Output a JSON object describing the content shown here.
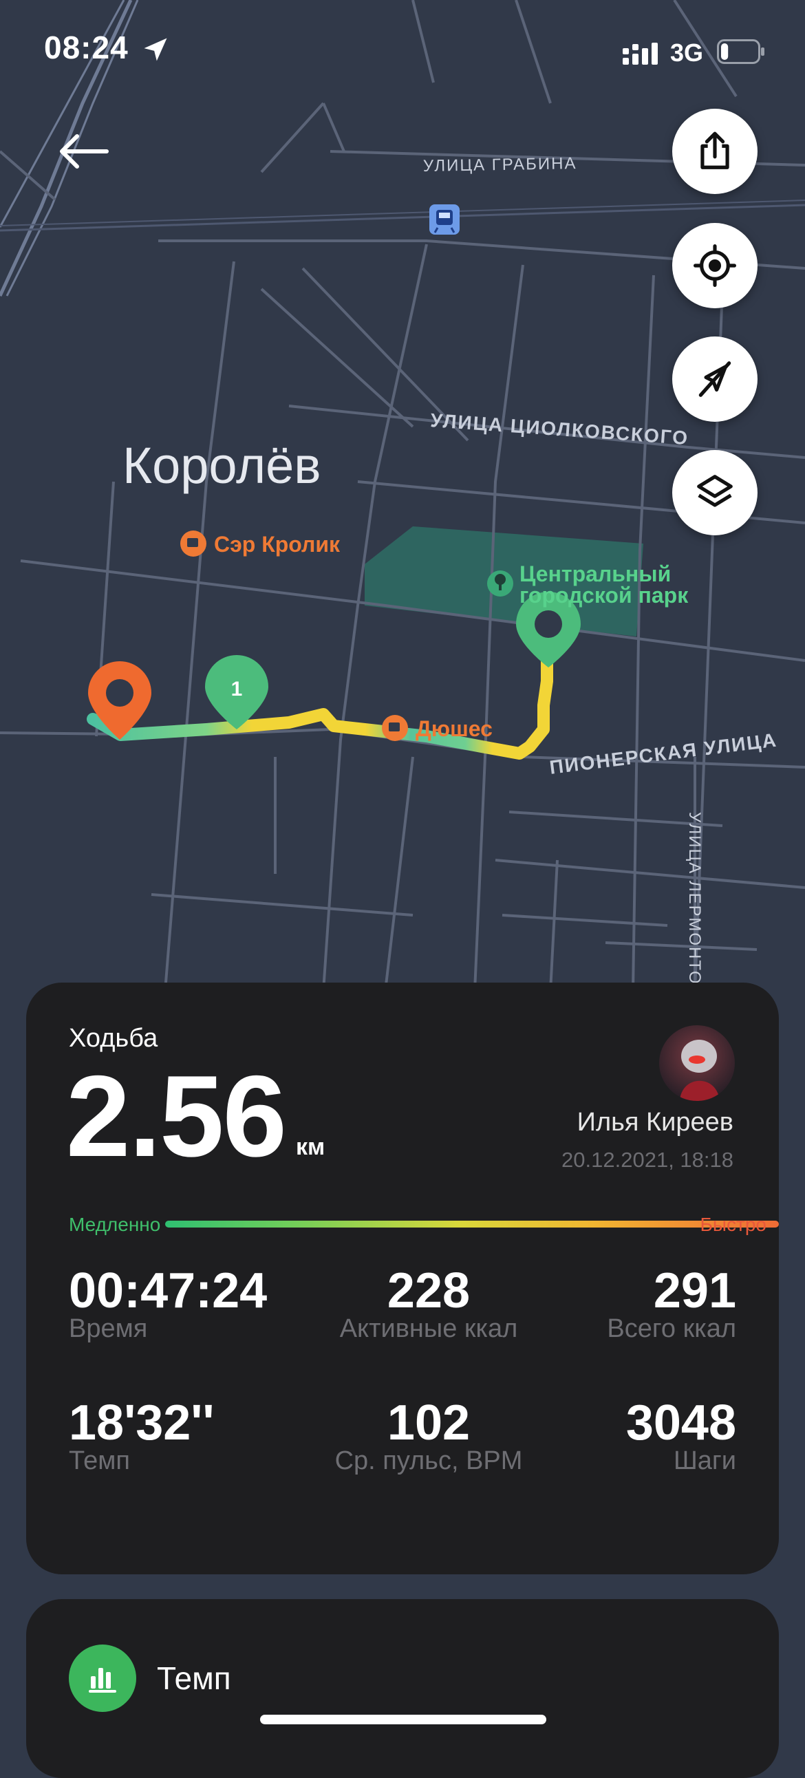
{
  "status_bar": {
    "time": "08:24",
    "network": "3G",
    "battery_level": 0.2
  },
  "map": {
    "city": "Королёв",
    "streets": [
      "УЛИЦА ГРАБИНА",
      "УЛИЦА ЦИОЛКОВСКОГО",
      "ПИОНЕРСКАЯ УЛИЦА",
      "УЛИЦА ЛЕРМОНТО"
    ],
    "places": {
      "cafe1": "Сэр Кролик",
      "park_line1": "Центральный",
      "park_line2": "городской парк",
      "cafe2": "Дюшес"
    },
    "marker_lap": "1",
    "buttons": [
      "share-icon",
      "locate-icon",
      "hide-route-icon",
      "layers-icon"
    ]
  },
  "summary": {
    "activity_type": "Ходьба",
    "distance": "2.56",
    "distance_unit": "км",
    "user_name": "Илья Киреев",
    "date": "20.12.2021, 18:18",
    "speed_slow": "Медленно",
    "speed_fast": "Быстро",
    "stats": [
      {
        "value": "00:47:24",
        "label": "Время"
      },
      {
        "value": "228",
        "label": "Активные ккал"
      },
      {
        "value": "291",
        "label": "Всего ккал"
      },
      {
        "value": "18'32''",
        "label": "Темп"
      },
      {
        "value": "102",
        "label": "Ср. пульс, BPM"
      },
      {
        "value": "3048",
        "label": "Шаги"
      }
    ]
  },
  "pace_section": {
    "title": "Темп"
  },
  "colors": {
    "map_bg": "#313949",
    "card_bg": "#1e1e20",
    "accent_green": "#3cb65c",
    "start_marker": "#ef6a2f",
    "route_yellow": "#f2d537",
    "route_green": "#45c08a"
  }
}
